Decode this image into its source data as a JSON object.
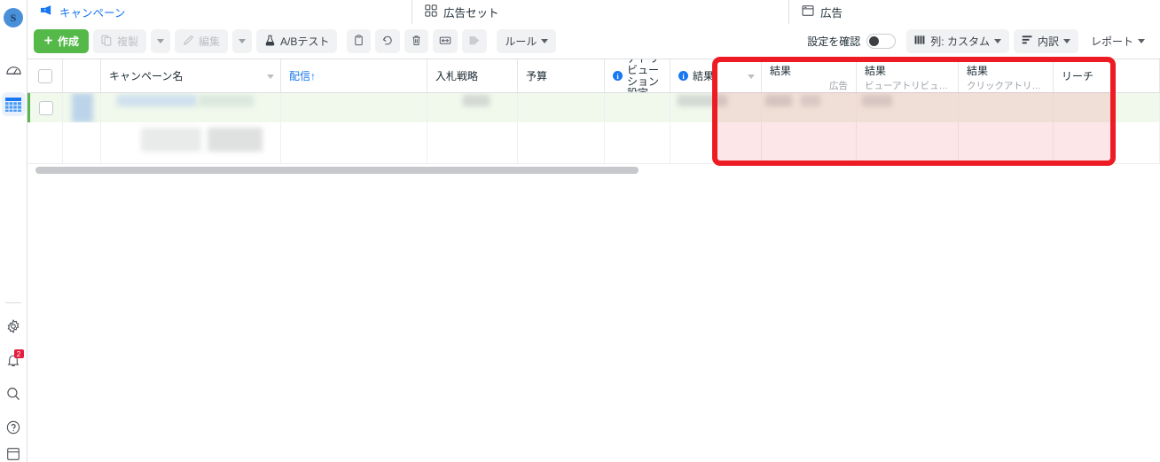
{
  "rail": {
    "avatar_label": "S",
    "items": [
      {
        "name": "avatar",
        "label": "S"
      },
      {
        "name": "dashboard-icon",
        "label": "ダッシュボード"
      },
      {
        "name": "table-icon",
        "label": "広告マネージャ"
      },
      {
        "name": "gear-icon",
        "label": "設定"
      },
      {
        "name": "bell-icon",
        "label": "お知らせ",
        "badge": "2"
      },
      {
        "name": "search-icon",
        "label": "検索"
      },
      {
        "name": "help-icon",
        "label": "ヘルプ"
      }
    ],
    "bell_badge": "2"
  },
  "tabs": [
    {
      "id": "campaign",
      "label": "キャンペーン",
      "icon": "megaphone-icon",
      "active": true
    },
    {
      "id": "adset",
      "label": "広告セット",
      "icon": "grid-icon",
      "active": false
    },
    {
      "id": "ad",
      "label": "広告",
      "icon": "window-icon",
      "active": false
    }
  ],
  "toolbar": {
    "create_label": "作成",
    "duplicate_label": "複製",
    "edit_label": "編集",
    "abtest_label": "A/Bテスト",
    "rules_label": "ルール",
    "setting_check_label": "設定を確認",
    "columns_label": "列: カスタム",
    "breakdown_label": "内訳",
    "reports_label": "レポート",
    "icons": {
      "plus": "plus-icon",
      "duplicate": "copy-icon",
      "edit": "pencil-icon",
      "abtest": "flask-icon",
      "clipboard": "clipboard-icon",
      "undo": "undo-icon",
      "delete": "trash-icon",
      "export": "export-icon",
      "tag": "tag-icon",
      "columns": "columns-icon",
      "breakdown": "breakdown-icon"
    }
  },
  "table": {
    "columns": [
      {
        "key": "checkbox",
        "label": "",
        "cls": "c-chk"
      },
      {
        "key": "toggle",
        "label": "",
        "cls": "c-tog"
      },
      {
        "key": "name",
        "label": "キャンペーン名",
        "cls": "c-name",
        "sortable": true
      },
      {
        "key": "delivery",
        "label": "配信↑",
        "cls": "c-deliv",
        "link": true
      },
      {
        "key": "bid",
        "label": "入札戦略",
        "cls": "c-bid"
      },
      {
        "key": "budget",
        "label": "予算",
        "cls": "c-budget"
      },
      {
        "key": "attribution",
        "label": "アトリビューション設定",
        "cls": "c-attr",
        "info": true
      },
      {
        "key": "result1",
        "label": "結果",
        "sub": "",
        "cls": "c-res1",
        "info": true,
        "sortable": true
      },
      {
        "key": "result2",
        "label": "結果",
        "sub": "広告",
        "cls": "c-res2"
      },
      {
        "key": "result3",
        "label": "結果",
        "sub": "ビューアトリビューシ…",
        "cls": "c-res3"
      },
      {
        "key": "result4",
        "label": "結果",
        "sub": "クリックアトリビュー…",
        "cls": "c-res4"
      },
      {
        "key": "reach",
        "label": "リーチ",
        "cls": "c-reach"
      }
    ],
    "rows": [
      {
        "selected": true,
        "redacted": true
      },
      {
        "selected": false,
        "redacted": true
      }
    ]
  },
  "highlight": {
    "color": "#ed1c24",
    "target": "結果 列グループ"
  },
  "colors": {
    "accent_blue": "#1877f2",
    "create_green": "#55b94a",
    "selected_row": "#f1f8ec",
    "selected_bar": "#5bb64f",
    "highlight_red": "#ed1c24",
    "badge_red": "#e41e3f"
  }
}
